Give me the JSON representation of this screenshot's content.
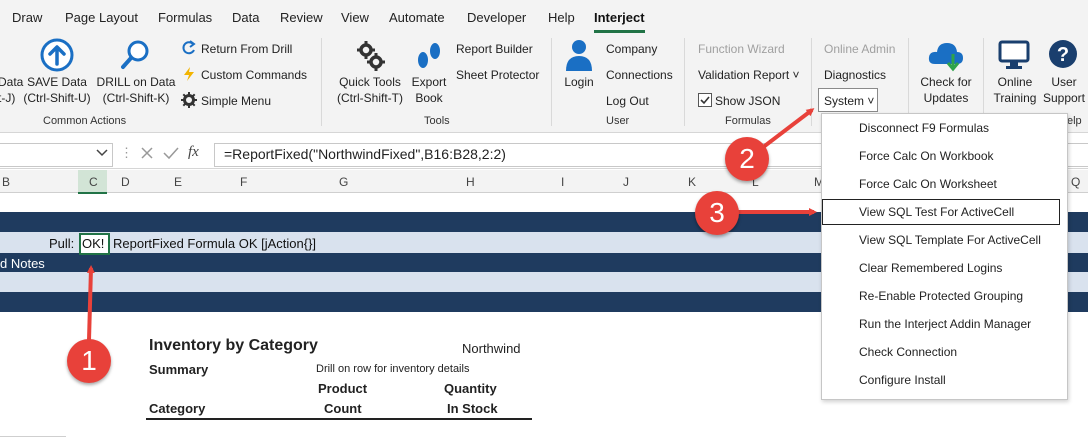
{
  "menu": {
    "tabs": [
      "Draw",
      "Page Layout",
      "Formulas",
      "Data",
      "Review",
      "View",
      "Automate",
      "Developer",
      "Help",
      "Interject"
    ],
    "active": "Interject"
  },
  "ribbon": {
    "common_actions": {
      "save_partial_line1": "Data",
      "save_partial_line2": "t-J)",
      "save_line1": "SAVE Data",
      "save_line2": "(Ctrl-Shift-U)",
      "drill_line1": "DRILL on Data",
      "drill_line2": "(Ctrl-Shift-K)",
      "return_from_drill": "Return From Drill",
      "custom_commands": "Custom Commands",
      "simple_menu": "Simple Menu",
      "group_label": "Common Actions"
    },
    "tools": {
      "quick_tools_line1": "Quick Tools",
      "quick_tools_line2": "(Ctrl-Shift-T)",
      "export_line1": "Export",
      "export_line2": "Book",
      "report_builder": "Report Builder",
      "sheet_protector": "Sheet Protector",
      "group_label": "Tools"
    },
    "user": {
      "login": "Login",
      "company": "Company",
      "connections": "Connections",
      "logout": "Log Out",
      "group_label": "User"
    },
    "formulas": {
      "function_wizard": "Function Wizard",
      "validation_report": "Validation Report ˅",
      "show_json": "Show JSON",
      "group_label": "Formulas"
    },
    "admin": {
      "online_admin": "Online Admin",
      "diagnostics": "Diagnostics",
      "system": "System ˅"
    },
    "updates": {
      "check_line1": "Check for",
      "check_line2": "Updates"
    },
    "help": {
      "online_line1": "Online",
      "online_line2": "Training",
      "user_line1": "User",
      "user_line2": "Support",
      "group_label_partial": "elp"
    }
  },
  "formula_bar": {
    "fx": "fx",
    "formula": "=ReportFixed(\"NorthwindFixed\",B16:B28,2:2)"
  },
  "columns": [
    "B",
    "C",
    "D",
    "E",
    "F",
    "G",
    "H",
    "I",
    "J",
    "K",
    "L",
    "M",
    "Q"
  ],
  "sheet": {
    "pull_label": "Pull:",
    "ok_cell": "OK!",
    "status_text": "ReportFixed Formula OK [jAction{}]",
    "notes_partial": "d Notes"
  },
  "report": {
    "title": "Inventory by Category",
    "company": "Northwind",
    "summary": "Summary",
    "drill_hint": "Drill on row for inventory details",
    "col_product_1": "Product",
    "col_product_2": "Count",
    "col_quantity_1": "Quantity",
    "col_quantity_2": "In Stock",
    "col_category": "Category"
  },
  "system_menu": {
    "items": [
      "Disconnect F9 Formulas",
      "Force Calc On Workbook",
      "Force Calc On Worksheet",
      "View SQL Test For ActiveCell",
      "View SQL Template For ActiveCell",
      "Clear Remembered Logins",
      "Re-Enable Protected Grouping",
      "Run the Interject Addin Manager",
      "Check Connection",
      "Configure Install"
    ],
    "highlighted_index": 3
  },
  "callouts": [
    "1",
    "2",
    "3"
  ],
  "colors": {
    "accent_green": "#217346",
    "navy_row": "#1f3b5f",
    "light_row": "#d9e2ee",
    "callout_red": "#e8413a",
    "icon_blue": "#1a6fc4"
  }
}
